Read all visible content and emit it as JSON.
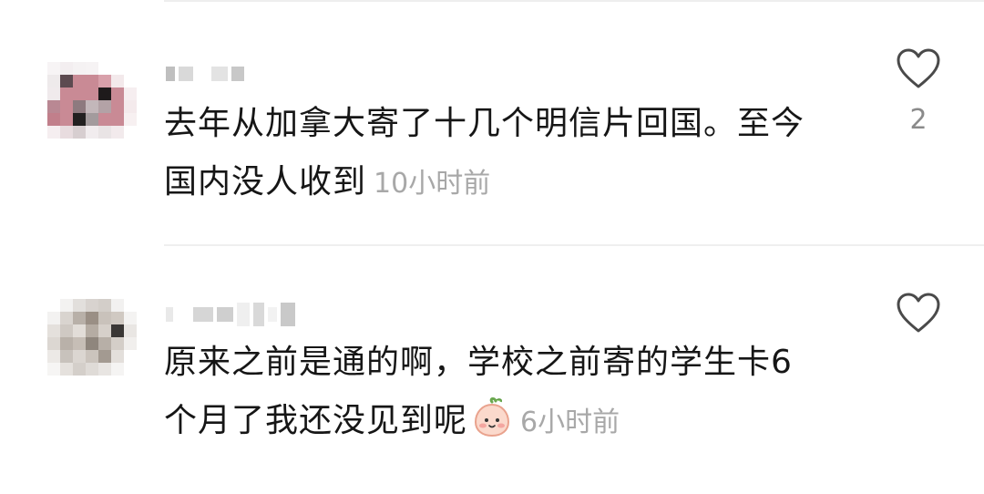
{
  "comments": [
    {
      "text_lines": [
        "去年从加拿大寄了十几个明信片回国。至今",
        "国内没人收到"
      ],
      "timestamp": "10小时前",
      "like_count": "2",
      "has_emoji": false
    },
    {
      "text_lines": [
        "原来之前是通的啊，学校之前寄的学生卡6",
        "个月了我还没见到呢"
      ],
      "timestamp": "6小时前",
      "like_count": "",
      "has_emoji": true
    }
  ],
  "icons": {
    "like": "heart-outline-icon",
    "emoji": "peach-face-emoji-icon"
  },
  "colors": {
    "text": "#161616",
    "meta": "#a8a8a8",
    "like_count": "#8a8a8a",
    "icon_stroke": "#4a4a4a",
    "divider": "#efefef"
  }
}
